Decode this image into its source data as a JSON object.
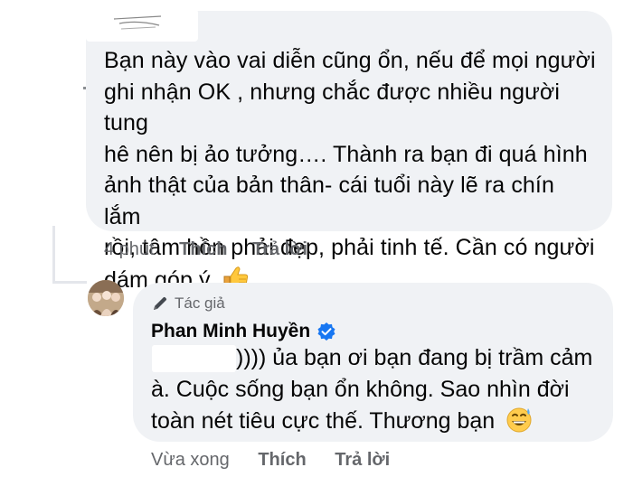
{
  "comment1": {
    "text_lines": [
      "Bạn này vào vai diễn cũng ổn, nếu để mọi người",
      "ghi nhận OK , nhưng chắc được nhiều người tung",
      "hê nên bị ảo tưởng…. Thành ra bạn đi quá hình",
      "ảnh thật của bản thân- cái tuổi này lẽ ra chín lắm",
      "rồi, tâm hồn phải đẹp, phải tinh tế. Cần có người",
      "dám góp ý"
    ],
    "emoji": "thumbs-up",
    "time": "4 phút",
    "like_label": "Thích",
    "reply_label": "Trả lời"
  },
  "reply": {
    "badge": "Tác giả",
    "author": "Phan Minh Huyền",
    "verified": true,
    "text_lines": [
      ")))) ủa bạn ơi bạn đang bị trầm cảm",
      "à. Cuộc sống bạn ổn không. Sao nhìn đời",
      "toàn nét tiêu cực thế. Thương bạn"
    ],
    "emoji": "grinning-sweat",
    "time": "Vừa xong",
    "like_label": "Thích",
    "reply_label": "Trả lời"
  },
  "colors": {
    "bubble": "#f0f2f5",
    "secondary_text": "#65676b",
    "verified_blue": "#1877f2"
  }
}
